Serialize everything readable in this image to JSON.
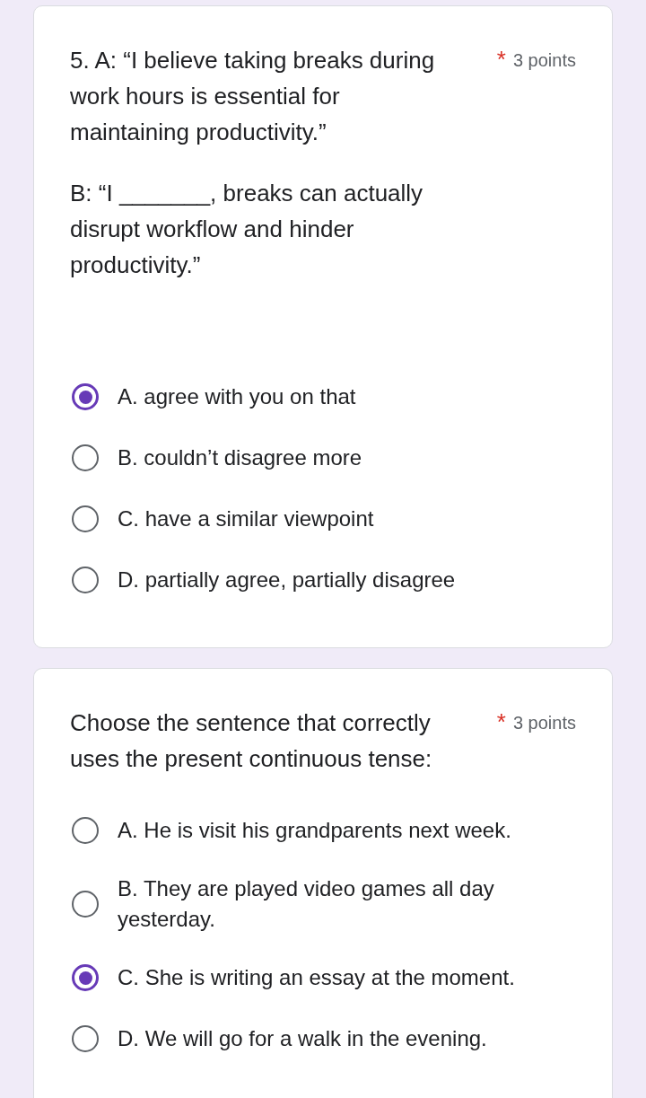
{
  "questions": [
    {
      "paragraphs": [
        "5. A: “I believe taking breaks during work hours is essential for maintaining productivity.”",
        "B: “I _______, breaks can actually disrupt workflow and hinder productivity.”"
      ],
      "required_mark": "*",
      "points": "3 points",
      "options": [
        {
          "label": "A. agree with you on that",
          "selected": true
        },
        {
          "label": "B. couldn’t disagree more",
          "selected": false
        },
        {
          "label": "C. have a similar viewpoint",
          "selected": false
        },
        {
          "label": "D. partially agree, partially disagree",
          "selected": false
        }
      ]
    },
    {
      "paragraphs": [
        "Choose the sentence that correctly uses the present continuous tense:"
      ],
      "required_mark": "*",
      "points": "3 points",
      "options": [
        {
          "label": "A. He is visit his grandparents next week.",
          "selected": false
        },
        {
          "label": "B. They are played video games all day yesterday.",
          "selected": false
        },
        {
          "label": "C. She is writing an essay at the moment.",
          "selected": true
        },
        {
          "label": "D. We will go for a walk in the evening.",
          "selected": false
        }
      ]
    }
  ]
}
